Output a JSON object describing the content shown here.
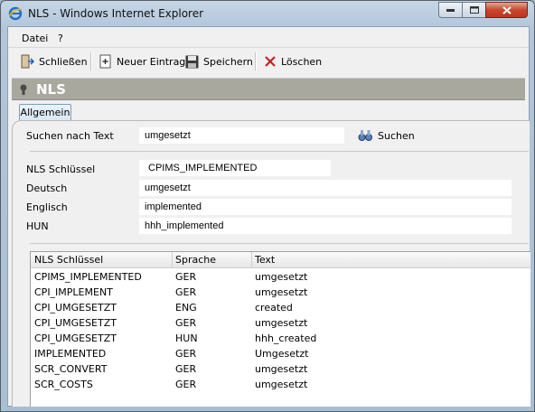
{
  "window": {
    "title": "NLS - Windows Internet Explorer"
  },
  "menu": {
    "items": [
      "Datei",
      "?"
    ]
  },
  "toolbar": {
    "close_label": "Schließen",
    "new_label": "Neuer Eintrag",
    "save_label": "Speichern",
    "delete_label": "Löschen"
  },
  "section": {
    "title": "NLS"
  },
  "tabs": [
    {
      "label": "Allgemein"
    }
  ],
  "search": {
    "label": "Suchen nach Text",
    "value": "umgesetzt",
    "button_label": "Suchen"
  },
  "form": {
    "key_label": "NLS Schlüssel",
    "key_value": "CPIMS_IMPLEMENTED",
    "de_label": "Deutsch",
    "de_value": "umgesetzt",
    "en_label": "Englisch",
    "en_value": "implemented",
    "hun_label": "HUN",
    "hun_value": "hhh_implemented"
  },
  "table": {
    "columns": [
      "NLS Schlüssel",
      "Sprache",
      "Text"
    ],
    "rows": [
      [
        "CPIMS_IMPLEMENTED",
        "GER",
        "umgesetzt"
      ],
      [
        "CPI_IMPLEMENT",
        "GER",
        "umgesetzt"
      ],
      [
        "CPI_UMGESETZT",
        "ENG",
        "created"
      ],
      [
        "CPI_UMGESETZT",
        "GER",
        "umgesetzt"
      ],
      [
        "CPI_UMGESETZT",
        "HUN",
        "hhh_created"
      ],
      [
        "IMPLEMENTED",
        "GER",
        "Umgesetzt"
      ],
      [
        "SCR_CONVERT",
        "GER",
        "umgesetzt"
      ],
      [
        "SCR_COSTS",
        "GER",
        "umgesetzt"
      ]
    ]
  },
  "colors": {
    "section_header": "#a9a89f",
    "close_button": "#c9462c"
  }
}
